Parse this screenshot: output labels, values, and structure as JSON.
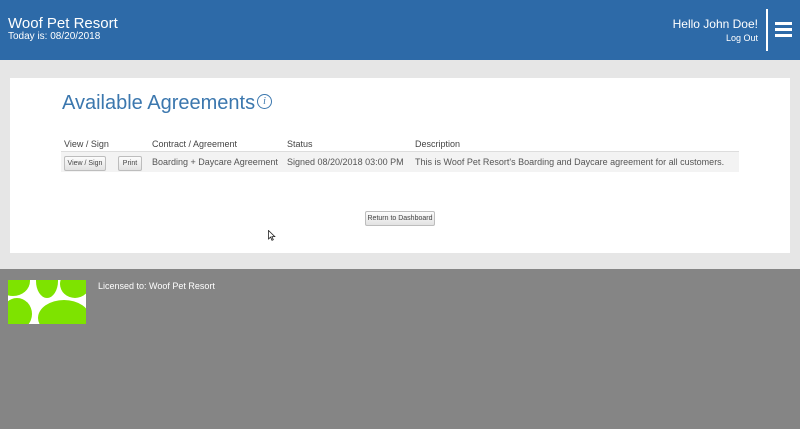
{
  "header": {
    "brand": "Woof Pet Resort",
    "today": "Today is: 08/20/2018",
    "greeting": "Hello John Doe!",
    "logout": "Log Out",
    "menu_icon": "hamburger-icon"
  },
  "main": {
    "title": "Available Agreements",
    "info_icon_glyph": "i",
    "table": {
      "columns": [
        "View / Sign",
        "Contract / Agreement",
        "Status",
        "Description"
      ],
      "rows": [
        {
          "view_label": "View / Sign",
          "print_label": "Print",
          "contract": "Boarding + Daycare Agreement",
          "status": "Signed 08/20/2018 03:00 PM",
          "description": "This is Woof Pet Resort's Boarding and Daycare agreement for all customers."
        }
      ]
    },
    "return_button": "Return to Dashboard"
  },
  "footer": {
    "licensed": "Licensed to: Woof Pet Resort"
  },
  "colors": {
    "header_bg": "#2d6aa8",
    "title_blue": "#3b77ae",
    "paw_green": "#7ee300",
    "footer_bg": "#858585"
  }
}
